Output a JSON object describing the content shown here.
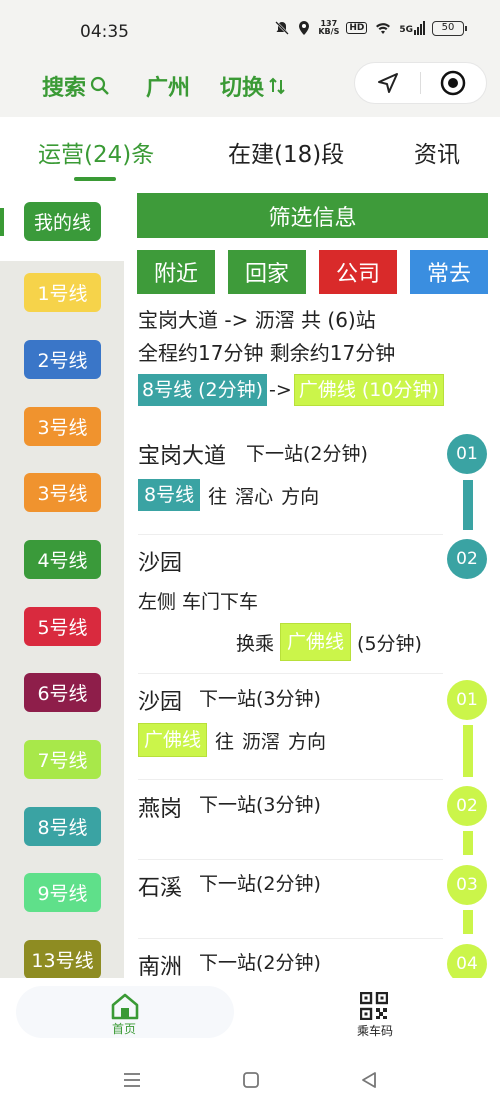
{
  "status_bar": {
    "time": "04:35",
    "speed_top": "137",
    "speed_bottom": "KB/S",
    "hd": "HD",
    "network": "5G",
    "battery": "50"
  },
  "topbar": {
    "search_label": "搜索",
    "city": "广州",
    "switch_label": "切换"
  },
  "tabs": [
    "运营(24)条",
    "在建(18)段",
    "资讯"
  ],
  "sidebar": {
    "my_lines": "我的线",
    "lines": [
      {
        "label": "1号线",
        "color": "#f6d34a"
      },
      {
        "label": "2号线",
        "color": "#3a76c8"
      },
      {
        "label": "3号线",
        "color": "#f0932e"
      },
      {
        "label": "3号线",
        "color": "#f0932e"
      },
      {
        "label": "4号线",
        "color": "#3a9a3a"
      },
      {
        "label": "5号线",
        "color": "#d92a3e"
      },
      {
        "label": "6号线",
        "color": "#8e1e4a"
      },
      {
        "label": "7号线",
        "color": "#a8e84a"
      },
      {
        "label": "8号线",
        "color": "#3aa3a3"
      },
      {
        "label": "9号线",
        "color": "#5fe08a"
      },
      {
        "label": "13号线",
        "color": "#8e8c22"
      }
    ]
  },
  "main": {
    "filter_label": "筛选信息",
    "quick_buttons": [
      {
        "label": "附近",
        "color": "#3e9b3a"
      },
      {
        "label": "回家",
        "color": "#3e9b3a"
      },
      {
        "label": "公司",
        "color": "#d92a2a"
      },
      {
        "label": "常去",
        "color": "#3a8ee0"
      }
    ],
    "route_summary": "宝岗大道 -> 沥滘 共 (6)站",
    "time_summary": "全程约17分钟 剩余约17分钟",
    "segment_1": "8号线 (2分钟)",
    "segment_arrow": "->",
    "segment_2": "广佛线 (10分钟)",
    "stations": [
      {
        "name": "宝岗大道",
        "next": "下一站(2分钟)",
        "num": "01"
      },
      {
        "name": "沙园",
        "num": "02"
      },
      {
        "name": "沙园",
        "next": "下一站(3分钟)",
        "num": "01"
      },
      {
        "name": "燕岗",
        "next": "下一站(3分钟)",
        "num": "02"
      },
      {
        "name": "石溪",
        "next": "下一站(2分钟)",
        "num": "03"
      },
      {
        "name": "南洲",
        "next": "下一站(2分钟)",
        "num": "04"
      }
    ],
    "line8_tag": "8号线",
    "dir_1_prefix": "往",
    "dir_1_target": "滘心",
    "dir_suffix": "方向",
    "alight_side": "左侧",
    "alight_text": "车门下车",
    "transfer_prefix": "换乘",
    "transfer_line": "广佛线",
    "transfer_time": "(5分钟)",
    "gf_tag": "广佛线",
    "dir_2_prefix": "往",
    "dir_2_target": "沥滘"
  },
  "bottom_nav": {
    "home": "首页",
    "qr": "乘车码"
  }
}
